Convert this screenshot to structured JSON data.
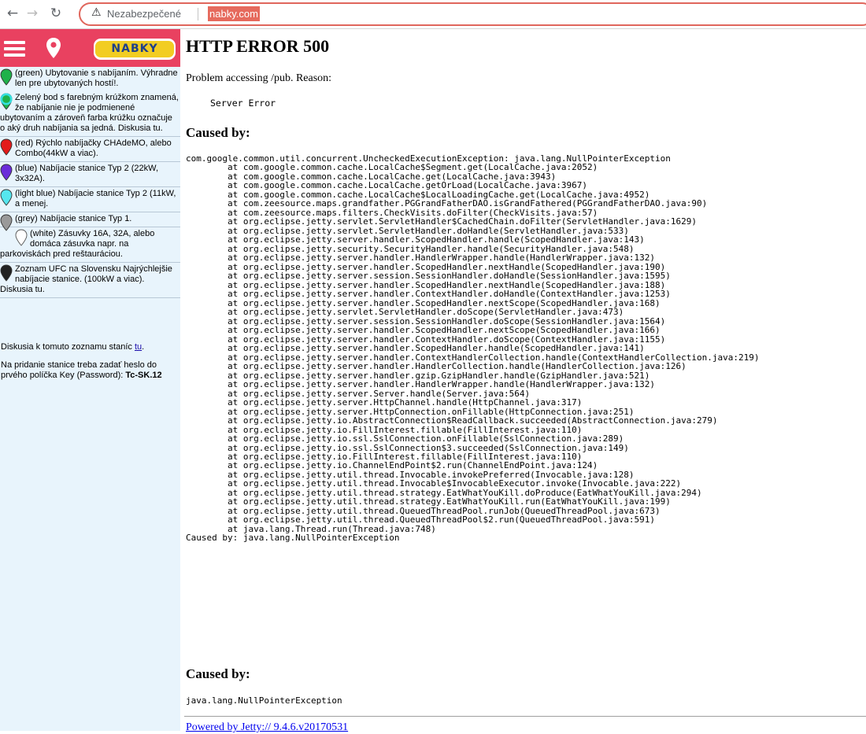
{
  "browser": {
    "security_label": "Nezabezpečené",
    "url": "nabky.com",
    "accent": "#e66a5d"
  },
  "sidebar": {
    "logo_text": "NABKY",
    "header_color": "#e94160",
    "legend": [
      {
        "color": "#1fb24a",
        "ring": "",
        "text": "(green) Ubytovanie s nabíjaním. Výhradne len pre ubytovaných hostí!."
      },
      {
        "color": "#1fb24a",
        "ring": "#35e0e0",
        "text": "Zelený bod s farebným krúžkom znamená, že nabíjanie nie je podmienené ubytovaním a zároveň farba krúžku označuje o aký druh nabíjania sa jedná. Diskusia tu."
      },
      {
        "color": "#e31b1b",
        "ring": "",
        "text": "(red) Rýchlo nabíjačky CHAdeMO, alebo Combo(44kW a viac)."
      },
      {
        "color": "#6a2bd9",
        "ring": "",
        "text": "(blue) Nabíjacie stanice Typ 2 (22kW, 3x32A)."
      },
      {
        "color": "#55e6ee",
        "ring": "",
        "text": "(light blue) Nabíjacie stanice Typ 2 (11kW, a menej."
      },
      {
        "color": "#9a9a9a",
        "ring": "",
        "text": "(grey) Nabíjacie stanice Typ 1."
      },
      {
        "color": "#ffffff",
        "ring": "",
        "text": "(white) Zásuvky 16A, 32A, alebo domáca zásuvka napr. na parkoviskách pred reštauráciou."
      },
      {
        "color": "#222222",
        "ring": "",
        "text": "Zoznam UFC na Slovensku Najrýchlejšie nabíjacie stanice. (100kW a viac). Diskusia tu."
      }
    ],
    "discussion_prefix": "Diskusia k tomuto zoznamu staníc ",
    "discussion_link": "tu",
    "discussion_suffix": ".",
    "password_note": "Na pridanie stanice treba zadať heslo do prvého políčka Key (Password): ",
    "password_value": "Tc-SK.12"
  },
  "error_page": {
    "title": "HTTP ERROR 500",
    "problem": "Problem accessing /pub. Reason:",
    "reason": "Server Error",
    "caused_by_heading": "Caused by:",
    "trace_lines": [
      "com.google.common.util.concurrent.UncheckedExecutionException: java.lang.NullPointerException",
      "\tat com.google.common.cache.LocalCache$Segment.get(LocalCache.java:2052)",
      "\tat com.google.common.cache.LocalCache.get(LocalCache.java:3943)",
      "\tat com.google.common.cache.LocalCache.getOrLoad(LocalCache.java:3967)",
      "\tat com.google.common.cache.LocalCache$LocalLoadingCache.get(LocalCache.java:4952)",
      "\tat com.zeesource.maps.grandfather.PGGrandFatherDAO.isGrandFathered(PGGrandFatherDAO.java:90)",
      "\tat com.zeesource.maps.filters.CheckVisits.doFilter(CheckVisits.java:57)",
      "\tat org.eclipse.jetty.servlet.ServletHandler$CachedChain.doFilter(ServletHandler.java:1629)",
      "\tat org.eclipse.jetty.servlet.ServletHandler.doHandle(ServletHandler.java:533)",
      "\tat org.eclipse.jetty.server.handler.ScopedHandler.handle(ScopedHandler.java:143)",
      "\tat org.eclipse.jetty.security.SecurityHandler.handle(SecurityHandler.java:548)",
      "\tat org.eclipse.jetty.server.handler.HandlerWrapper.handle(HandlerWrapper.java:132)",
      "\tat org.eclipse.jetty.server.handler.ScopedHandler.nextHandle(ScopedHandler.java:190)",
      "\tat org.eclipse.jetty.server.session.SessionHandler.doHandle(SessionHandler.java:1595)",
      "\tat org.eclipse.jetty.server.handler.ScopedHandler.nextHandle(ScopedHandler.java:188)",
      "\tat org.eclipse.jetty.server.handler.ContextHandler.doHandle(ContextHandler.java:1253)",
      "\tat org.eclipse.jetty.server.handler.ScopedHandler.nextScope(ScopedHandler.java:168)",
      "\tat org.eclipse.jetty.servlet.ServletHandler.doScope(ServletHandler.java:473)",
      "\tat org.eclipse.jetty.server.session.SessionHandler.doScope(SessionHandler.java:1564)",
      "\tat org.eclipse.jetty.server.handler.ScopedHandler.nextScope(ScopedHandler.java:166)",
      "\tat org.eclipse.jetty.server.handler.ContextHandler.doScope(ContextHandler.java:1155)",
      "\tat org.eclipse.jetty.server.handler.ScopedHandler.handle(ScopedHandler.java:141)",
      "\tat org.eclipse.jetty.server.handler.ContextHandlerCollection.handle(ContextHandlerCollection.java:219)",
      "\tat org.eclipse.jetty.server.handler.HandlerCollection.handle(HandlerCollection.java:126)",
      "\tat org.eclipse.jetty.server.handler.gzip.GzipHandler.handle(GzipHandler.java:521)",
      "\tat org.eclipse.jetty.server.handler.HandlerWrapper.handle(HandlerWrapper.java:132)",
      "\tat org.eclipse.jetty.server.Server.handle(Server.java:564)",
      "\tat org.eclipse.jetty.server.HttpChannel.handle(HttpChannel.java:317)",
      "\tat org.eclipse.jetty.server.HttpConnection.onFillable(HttpConnection.java:251)",
      "\tat org.eclipse.jetty.io.AbstractConnection$ReadCallback.succeeded(AbstractConnection.java:279)",
      "\tat org.eclipse.jetty.io.FillInterest.fillable(FillInterest.java:110)",
      "\tat org.eclipse.jetty.io.ssl.SslConnection.onFillable(SslConnection.java:289)",
      "\tat org.eclipse.jetty.io.ssl.SslConnection$3.succeeded(SslConnection.java:149)",
      "\tat org.eclipse.jetty.io.FillInterest.fillable(FillInterest.java:110)",
      "\tat org.eclipse.jetty.io.ChannelEndPoint$2.run(ChannelEndPoint.java:124)",
      "\tat org.eclipse.jetty.util.thread.Invocable.invokePreferred(Invocable.java:128)",
      "\tat org.eclipse.jetty.util.thread.Invocable$InvocableExecutor.invoke(Invocable.java:222)",
      "\tat org.eclipse.jetty.util.thread.strategy.EatWhatYouKill.doProduce(EatWhatYouKill.java:294)",
      "\tat org.eclipse.jetty.util.thread.strategy.EatWhatYouKill.run(EatWhatYouKill.java:199)",
      "\tat org.eclipse.jetty.util.thread.QueuedThreadPool.runJob(QueuedThreadPool.java:673)",
      "\tat org.eclipse.jetty.util.thread.QueuedThreadPool$2.run(QueuedThreadPool.java:591)",
      "\tat java.lang.Thread.run(Thread.java:748)",
      "Caused by: java.lang.NullPointerException"
    ],
    "second_heading": "Caused by:",
    "second_cause": "java.lang.NullPointerException",
    "powered_by": "Powered by Jetty:// 9.4.6.v20170531"
  }
}
